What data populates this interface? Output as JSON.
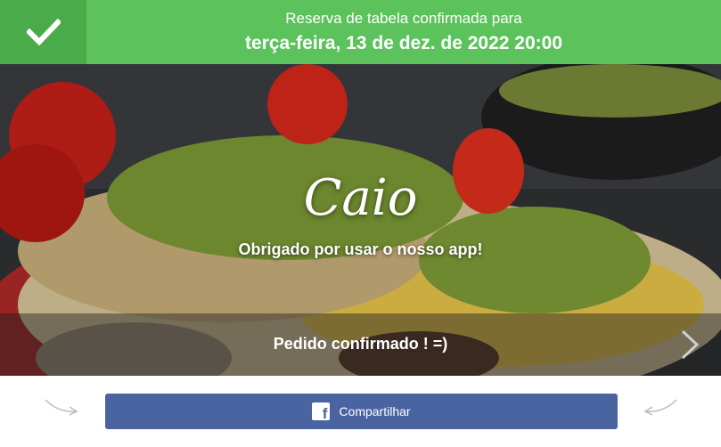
{
  "header": {
    "line1": "Reserva de tabela confirmada para",
    "line2": "terça-feira, 13 de dez. de 2022 20:00",
    "icon": "checkmark-icon"
  },
  "hero": {
    "name": "Caio",
    "thanks": "Obrigado por usar o nosso app!",
    "band_text": "Pedido confirmado ! =)",
    "next_icon": "chevron-right-icon"
  },
  "footer": {
    "share_label": "Compartilhar",
    "share_icon": "facebook-icon",
    "colors": {
      "share_bg": "#4a64a1",
      "header_bg": "#5cc25c"
    }
  }
}
